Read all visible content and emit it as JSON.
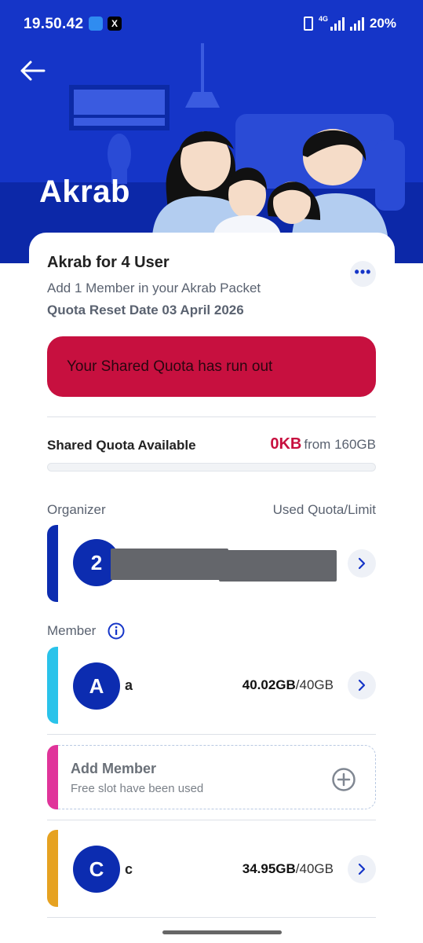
{
  "status_bar": {
    "time": "19.50.42",
    "app_icon_2": "X",
    "network": "4G",
    "battery": "20%"
  },
  "header": {
    "title": "Akrab"
  },
  "plan": {
    "title": "Akrab for 4 User",
    "subtitle": "Add 1 Member in your Akrab Packet",
    "reset": "Quota Reset Date 03 April 2026"
  },
  "alert": {
    "text": "Your Shared Quota has run out"
  },
  "shared_quota": {
    "label": "Shared Quota Available",
    "available": "0KB",
    "total": "from 160GB",
    "fraction_used": 1.0
  },
  "organizer": {
    "section_label": "Organizer",
    "usage_header": "Used Quota/Limit",
    "initial": "2"
  },
  "members": {
    "section_label": "Member",
    "items": [
      {
        "initial": "A",
        "name": "a",
        "used": "40.02GB",
        "limit": "/40GB",
        "accent": "#2ac3ea"
      },
      {
        "initial": "C",
        "name": "c",
        "used": "34.95GB",
        "limit": "/40GB",
        "accent": "#e6a221"
      }
    ]
  },
  "add_member": {
    "title": "Add Member",
    "subtitle": "Free slot have been used"
  },
  "colors": {
    "primary": "#1535c8",
    "alert": "#c7103f",
    "organizer_accent": "#0c2cb0",
    "add_accent": "#e0349a"
  }
}
